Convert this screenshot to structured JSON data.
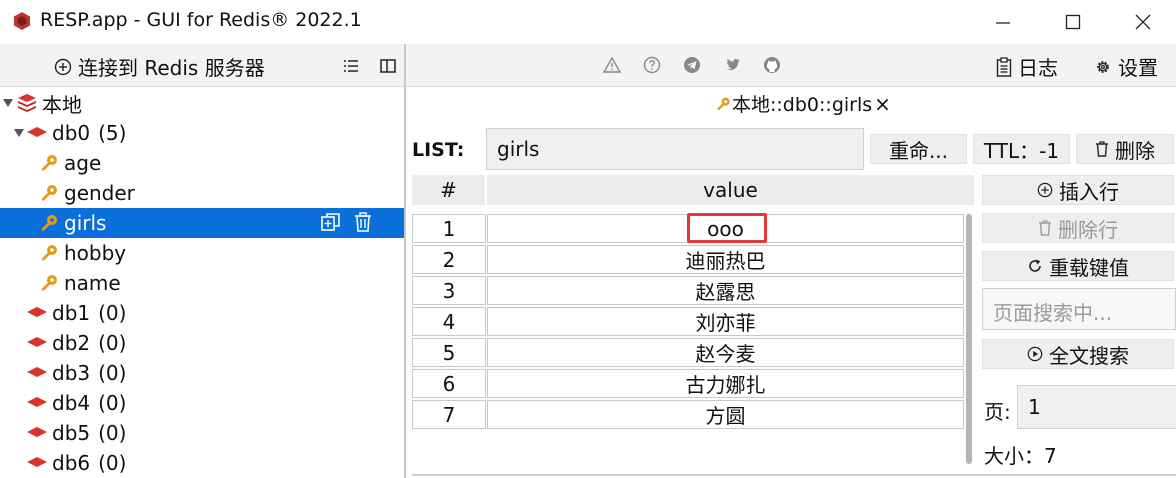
{
  "window": {
    "title": "RESP.app - GUI for Redis® 2022.1",
    "icons": [
      "app-icon",
      "minimize-icon",
      "maximize-icon",
      "close-icon"
    ]
  },
  "left_toolbar": {
    "connect_label": "连接到 Redis 服务器",
    "icons": [
      "plus-circle-icon",
      "list-icon",
      "panel-icon"
    ]
  },
  "tree": {
    "server": "本地",
    "db0": {
      "name": "db0",
      "count": "(5)"
    },
    "keys": [
      "age",
      "gender",
      "girls",
      "hobby",
      "name"
    ],
    "selected_key": "girls",
    "dbs": [
      {
        "name": "db1",
        "count": "(0)"
      },
      {
        "name": "db2",
        "count": "(0)"
      },
      {
        "name": "db3",
        "count": "(0)"
      },
      {
        "name": "db4",
        "count": "(0)"
      },
      {
        "name": "db5",
        "count": "(0)"
      },
      {
        "name": "db6",
        "count": "(0)"
      }
    ]
  },
  "right_toolbar": {
    "icons": [
      "warning-icon",
      "help-icon",
      "telegram-icon",
      "twitter-icon",
      "github-icon"
    ],
    "log_label": "日志",
    "settings_label": "设置"
  },
  "tab": {
    "label": "本地::db0::girls",
    "close": "×"
  },
  "key_view": {
    "type_label": "LIST:",
    "key_name": "girls",
    "rename_label": "重命...",
    "ttl_label": "TTL：-1",
    "delete_label": "删除"
  },
  "table": {
    "headers": [
      "#",
      "value"
    ],
    "rows": [
      {
        "index": "1",
        "value": "ooo"
      },
      {
        "index": "2",
        "value": "迪丽热巴"
      },
      {
        "index": "3",
        "value": "赵露思"
      },
      {
        "index": "4",
        "value": "刘亦菲"
      },
      {
        "index": "5",
        "value": "赵今麦"
      },
      {
        "index": "6",
        "value": "古力娜扎"
      },
      {
        "index": "7",
        "value": "方圆"
      }
    ]
  },
  "side_actions": {
    "insert_label": "插入行",
    "delete_row_label": "删除行",
    "reload_label": "重载键值",
    "search_placeholder": "页面搜索中...",
    "fulltext_label": "全文搜索",
    "page_label": "页:",
    "page_value": "1",
    "size_label": "大小：7"
  },
  "colors": {
    "selection": "#0a6fd8",
    "redis_red": "#d9332b",
    "key_orange": "#e69a17",
    "highlight_box": "#e53935"
  }
}
